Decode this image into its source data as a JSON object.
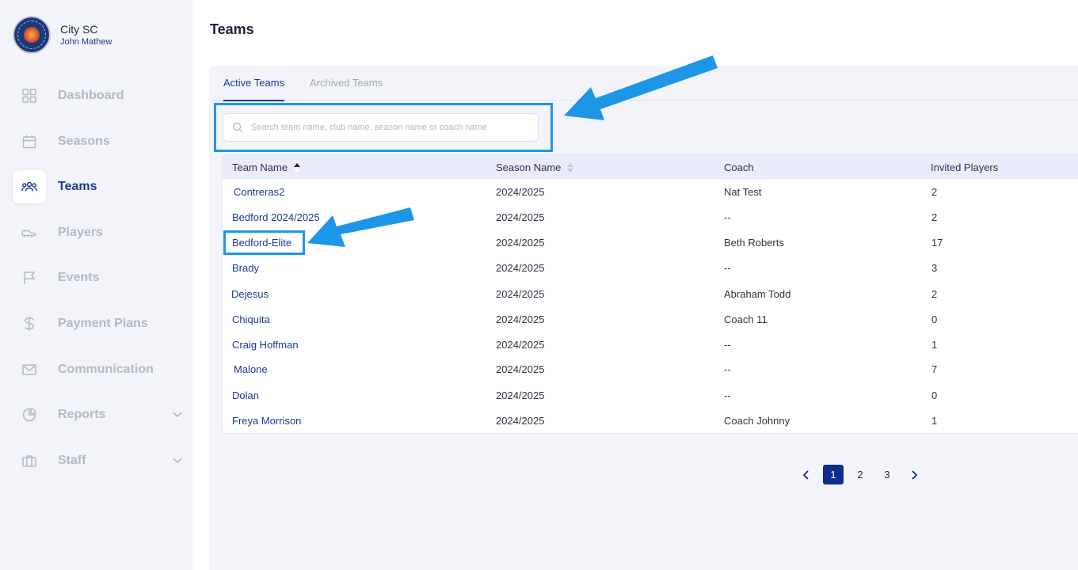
{
  "org": {
    "name": "City SC",
    "user": "John Mathew"
  },
  "nav": [
    {
      "label": "Dashboard",
      "icon": "dashboard-icon"
    },
    {
      "label": "Seasons",
      "icon": "calendar-icon"
    },
    {
      "label": "Teams",
      "icon": "team-icon",
      "active": true
    },
    {
      "label": "Players",
      "icon": "cleat-icon"
    },
    {
      "label": "Events",
      "icon": "flag-icon"
    },
    {
      "label": "Payment Plans",
      "icon": "dollar-icon"
    },
    {
      "label": "Communication",
      "icon": "mail-icon"
    },
    {
      "label": "Reports",
      "icon": "pie-chart-icon",
      "expandable": true
    },
    {
      "label": "Staff",
      "icon": "briefcase-icon",
      "expandable": true
    }
  ],
  "page": {
    "title": "Teams"
  },
  "tabs": {
    "active": "Active Teams",
    "archived": "Archived Teams"
  },
  "search": {
    "placeholder": "Search team name, club name, season name or coach name",
    "value": ""
  },
  "table": {
    "headers": {
      "team": "Team Name",
      "season": "Season Name",
      "coach": "Coach",
      "players": "Invited Players"
    },
    "rows": [
      {
        "team": "Contreras2",
        "season": "2024/2025",
        "coach": "Nat Test",
        "players": "2"
      },
      {
        "team": "Bedford 2024/2025",
        "season": "2024/2025",
        "coach": "--",
        "players": "2"
      },
      {
        "team": "Bedford-Elite",
        "season": "2024/2025",
        "coach": "Beth Roberts",
        "players": "17"
      },
      {
        "team": "Brady",
        "season": "2024/2025",
        "coach": "--",
        "players": "3"
      },
      {
        "team": "Dejesus",
        "season": "2024/2025",
        "coach": "Abraham Todd",
        "players": "2"
      },
      {
        "team": "Chiquita",
        "season": "2024/2025",
        "coach": "Coach 11",
        "players": "0"
      },
      {
        "team": "Craig Hoffman",
        "season": "2024/2025",
        "coach": "--",
        "players": "1"
      },
      {
        "team": "Malone",
        "season": "2024/2025",
        "coach": "--",
        "players": "7"
      },
      {
        "team": "Dolan",
        "season": "2024/2025",
        "coach": "--",
        "players": "0"
      },
      {
        "team": "Freya Morrison",
        "season": "2024/2025",
        "coach": "Coach Johnny",
        "players": "1"
      }
    ]
  },
  "pagination": {
    "pages": [
      "1",
      "2",
      "3"
    ],
    "current": "1"
  },
  "colors": {
    "accent": "#1c3a8d",
    "annotation": "#1e96e8",
    "sidebar_bg": "#f3f4f9"
  }
}
